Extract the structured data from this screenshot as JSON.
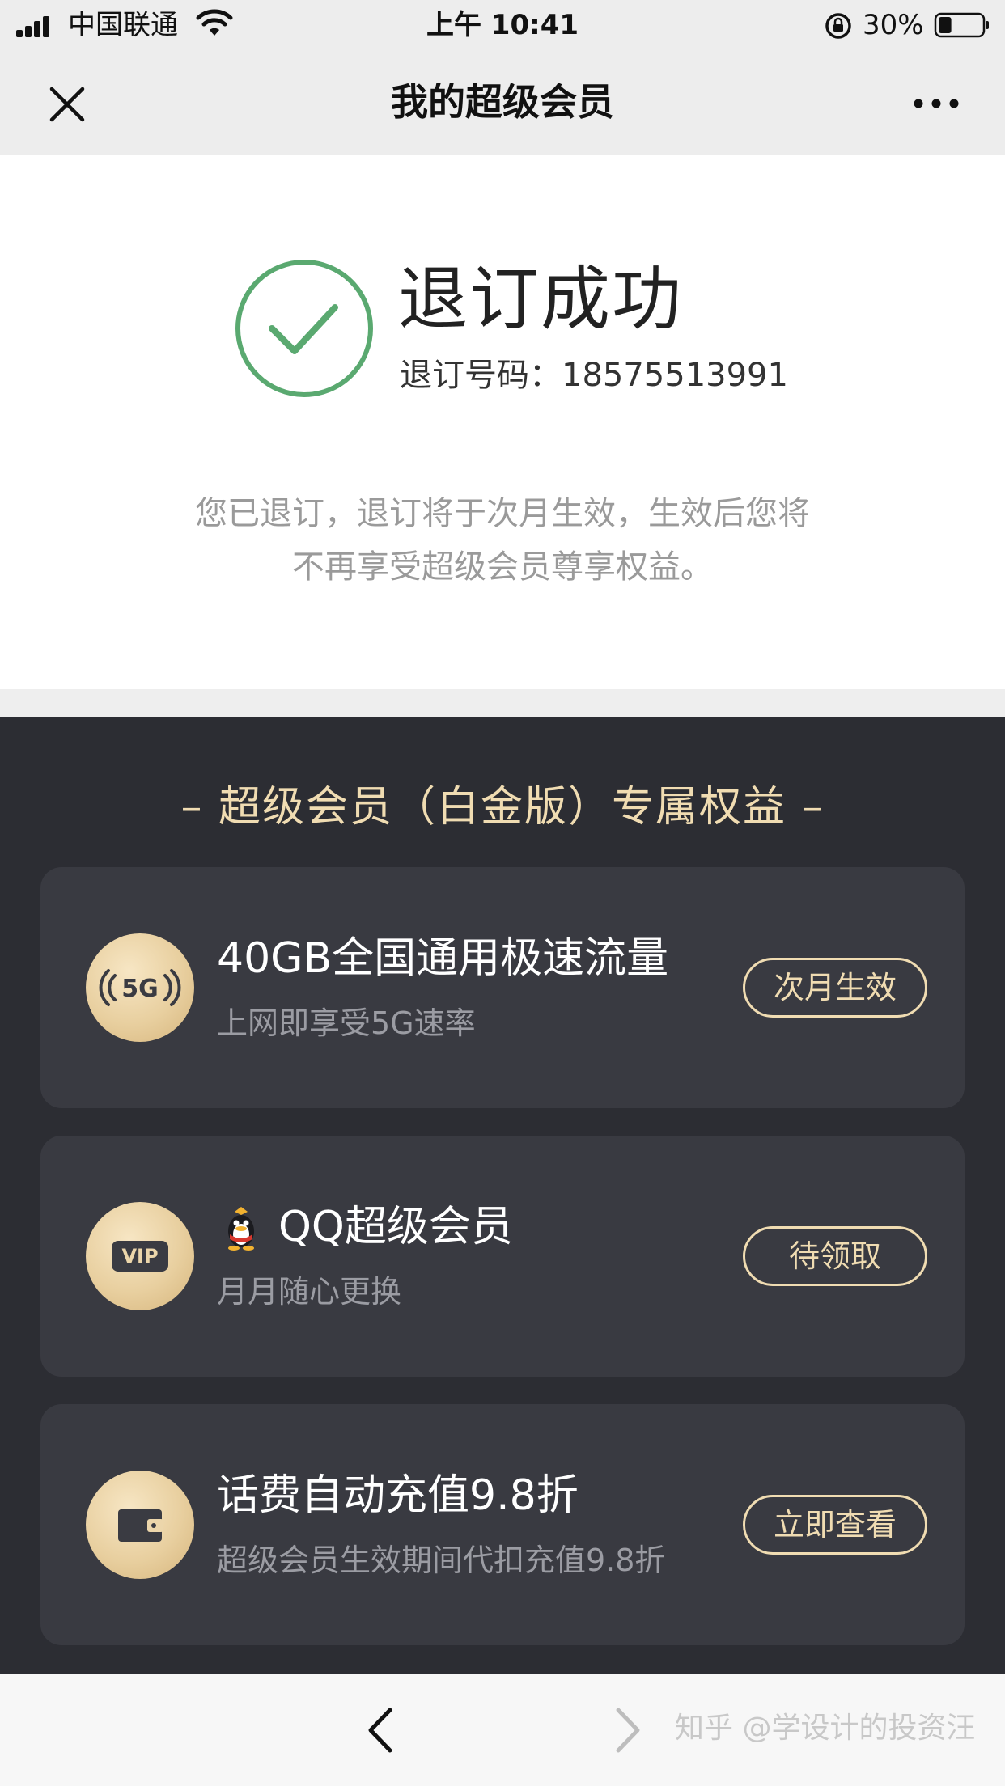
{
  "status_bar": {
    "carrier": "中国联通",
    "time": "上午 10:41",
    "battery_percent": "30%",
    "battery_level": 0.3
  },
  "nav": {
    "title": "我的超级会员",
    "close_icon": "close-icon",
    "more_icon": "more-icon"
  },
  "result": {
    "title": "退订成功",
    "order_label": "退订号码：",
    "order_number": "18575513991",
    "notice_line1": "您已退订，退订将于次月生效，生效后您将",
    "notice_line2": "不再享受超级会员尊享权益。",
    "check_color": "#5aa970"
  },
  "benefits": {
    "title": "– 超级会员（白金版）专属权益 –",
    "accent_color": "#f0dcb2",
    "cards": [
      {
        "icon": "5g-icon",
        "title": "40GB全国通用极速流量",
        "subtitle": "上网即享受5G速率",
        "button": "次月生效"
      },
      {
        "icon": "vip-icon",
        "title": "QQ超级会员",
        "subtitle": "月月随心更换",
        "button": "待领取"
      },
      {
        "icon": "wallet-icon",
        "title": "话费自动充值9.8折",
        "subtitle": "超级会员生效期间代扣充值9.8折",
        "button": "立即查看"
      }
    ]
  },
  "toolbar": {
    "back_icon": "back-icon",
    "forward_icon": "forward-icon",
    "watermark": "知乎 @学设计的投资汪"
  }
}
